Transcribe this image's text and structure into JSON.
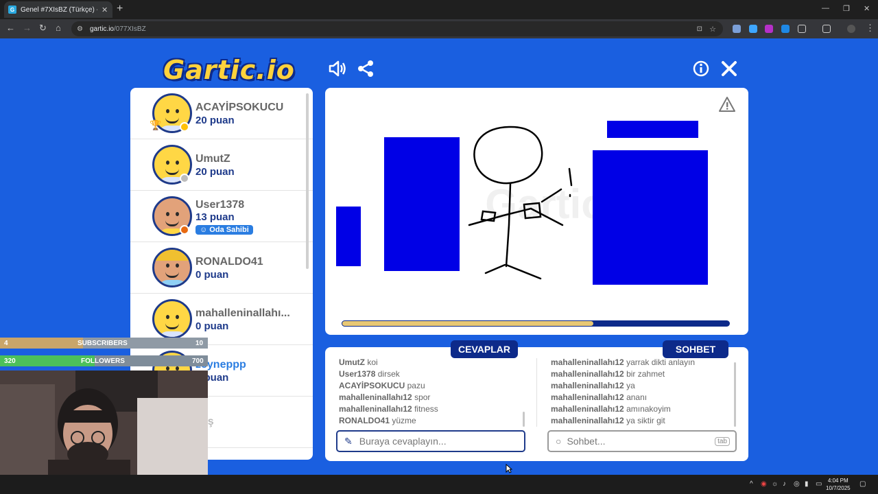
{
  "browser": {
    "tab_title": "Genel #7XIsBZ (Türkçe) - Gartic",
    "tab_close": "✕",
    "new_tab": "+",
    "url_host": "gartic.io",
    "url_path": "/077XIsBZ",
    "win_minimize": "—",
    "win_restore": "❐",
    "win_close": "✕"
  },
  "game": {
    "logo": "Gartic.io"
  },
  "players": [
    {
      "name": "ACAYİPSOKUCU",
      "score": "20 puan",
      "status_color": "#ffc107",
      "trophy": "🏆"
    },
    {
      "name": "UmutZ",
      "score": "20 puan",
      "status_color": "#bdbdbd"
    },
    {
      "name": "User1378",
      "score": "13 puan",
      "status_color": "#e86a12",
      "badge": "Oda Sahibi"
    },
    {
      "name": "RONALDO41",
      "score": "0 puan"
    },
    {
      "name": "mahalleninallahı...",
      "score": "0 puan"
    },
    {
      "name": "zeyneppp",
      "score": "0 puan"
    },
    {
      "name": "kaş",
      "score": ""
    }
  ],
  "board": {
    "progress": 0.65
  },
  "tabs": {
    "answers": "CEVAPLAR",
    "chat": "SOHBET"
  },
  "answers": [
    {
      "user": "UmutZ",
      "text": "koi"
    },
    {
      "user": "User1378",
      "text": "dirsek"
    },
    {
      "user": "ACAYİPSOKUCU",
      "text": "pazu"
    },
    {
      "user": "mahalleninallahı12",
      "text": "spor"
    },
    {
      "user": "mahalleninallahı12",
      "text": "fitness"
    },
    {
      "user": "RONALDO41",
      "text": "yüzme"
    }
  ],
  "chat": [
    {
      "user": "mahalleninallahı12",
      "text": "yarrak dikti anlayın"
    },
    {
      "user": "mahalleninallahı12",
      "text": "bir zahmet"
    },
    {
      "user": "mahalleninallahı12",
      "text": "ya"
    },
    {
      "user": "mahalleninallahı12",
      "text": "ananı"
    },
    {
      "user": "mahalleninallahı12",
      "text": "amınakoyim"
    },
    {
      "user": "mahalleninallahı12",
      "text": "ya siktir git"
    }
  ],
  "inputs": {
    "answer_placeholder": "Buraya cevaplayın...",
    "chat_placeholder": "Sohbet...",
    "tab_key": "tab"
  },
  "overlay": {
    "subs_count": "4",
    "subs_label": "SUBSCRIBERS",
    "subs_goal": "10",
    "subs_progress": 0.4,
    "followers_count": "320",
    "followers_label": "FOLLOWERS",
    "followers_goal": "700",
    "followers_progress": 0.457
  },
  "taskbar": {
    "time": "4:04 PM",
    "date": "10/7/2025"
  },
  "colors": {
    "background": "#1a5fe0",
    "navy": "#0d2a8a",
    "drawing_blue": "#0000e6",
    "progress_gold": "#e8c873"
  }
}
